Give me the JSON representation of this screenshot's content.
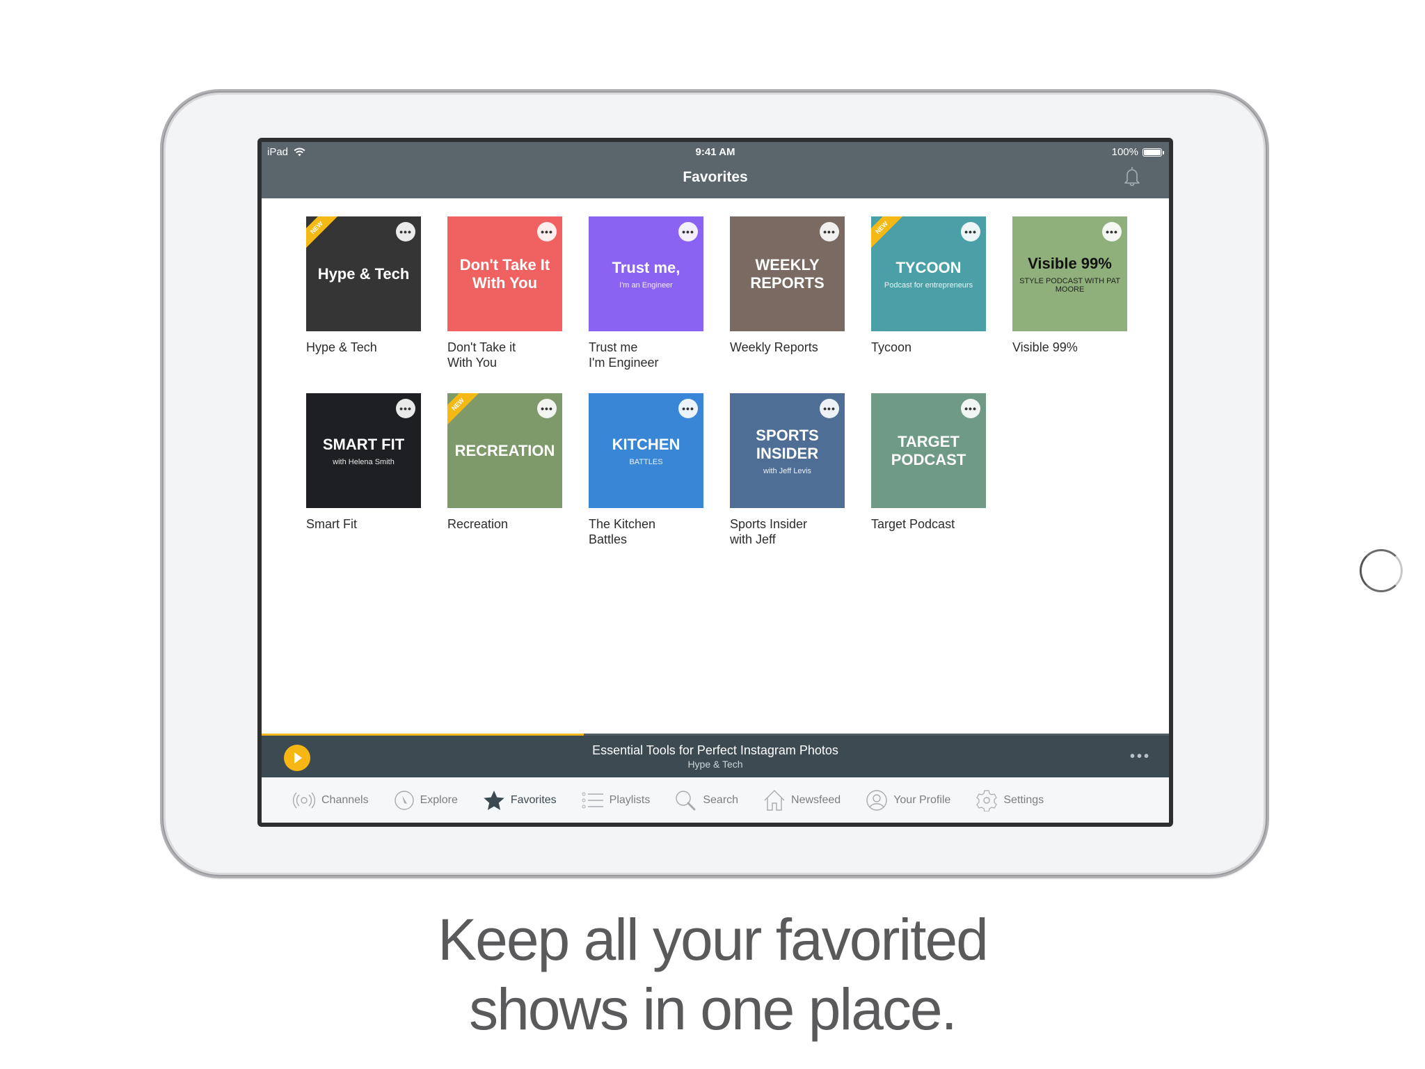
{
  "status_bar": {
    "device": "iPad",
    "time": "9:41 AM",
    "battery": "100%"
  },
  "nav": {
    "title": "Favorites",
    "bell_icon": "bell-icon"
  },
  "favorites": [
    {
      "title": "Hype & Tech",
      "art_text": "Hype & Tech",
      "art_sub": "",
      "is_new": true,
      "bg": "#353535",
      "fg": "#ffffff"
    },
    {
      "title": "Don't Take it\nWith You",
      "art_text": "Don't Take It With You",
      "art_sub": "",
      "is_new": false,
      "bg": "#f06162",
      "fg": "#ffffff"
    },
    {
      "title": "Trust me\nI'm Engineer",
      "art_text": "Trust me,",
      "art_sub": "I'm an Engineer",
      "is_new": false,
      "bg": "#8a63f2",
      "fg": "#ffffff"
    },
    {
      "title": "Weekly Reports",
      "art_text": "WEEKLY REPORTS",
      "art_sub": "",
      "is_new": false,
      "bg": "#7a6a62",
      "fg": "#ffffff"
    },
    {
      "title": "Tycoon",
      "art_text": "TYCOON",
      "art_sub": "Podcast for entrepreneurs",
      "is_new": true,
      "bg": "#4aa0a6",
      "fg": "#ffffff"
    },
    {
      "title": "Visible 99%",
      "art_text": "Visible 99%",
      "art_sub": "STYLE PODCAST WITH PAT MOORE",
      "is_new": false,
      "bg": "#8fb07a",
      "fg": "#111111"
    },
    {
      "title": "Smart Fit",
      "art_text": "SMART FIT",
      "art_sub": "with Helena Smith",
      "is_new": false,
      "bg": "#1e1f22",
      "fg": "#ffffff"
    },
    {
      "title": "Recreation",
      "art_text": "RECREATION",
      "art_sub": "",
      "is_new": true,
      "bg": "#7e9a6a",
      "fg": "#ffffff"
    },
    {
      "title": "The Kitchen\nBattles",
      "art_text": "KITCHEN",
      "art_sub": "BATTLES",
      "is_new": false,
      "bg": "#3a86d6",
      "fg": "#ffffff"
    },
    {
      "title": "Sports Insider\nwith Jeff",
      "art_text": "SPORTS INSIDER",
      "art_sub": "with Jeff Levis",
      "is_new": false,
      "bg": "#4f6e95",
      "fg": "#ffffff"
    },
    {
      "title": "Target Podcast",
      "art_text": "TARGET PODCAST",
      "art_sub": "",
      "is_new": false,
      "bg": "#6e9a86",
      "fg": "#ffffff"
    }
  ],
  "labels": {
    "new_badge": "NEW",
    "more": "•••"
  },
  "now_playing": {
    "title": "Essential Tools for Perfect Instagram Photos",
    "show": "Hype & Tech",
    "progress": 0.355,
    "more": "•••"
  },
  "tabs": [
    {
      "label": "Channels",
      "icon": "broadcast-icon",
      "active": false
    },
    {
      "label": "Explore",
      "icon": "compass-icon",
      "active": false
    },
    {
      "label": "Favorites",
      "icon": "star-icon",
      "active": true
    },
    {
      "label": "Playlists",
      "icon": "list-icon",
      "active": false
    },
    {
      "label": "Search",
      "icon": "search-icon",
      "active": false
    },
    {
      "label": "Newsfeed",
      "icon": "home-icon",
      "active": false
    },
    {
      "label": "Your Profile",
      "icon": "profile-icon",
      "active": false
    },
    {
      "label": "Settings",
      "icon": "gear-icon",
      "active": false
    }
  ],
  "caption": {
    "line1": "Keep all your favorited",
    "line2": "shows in one place."
  },
  "colors": {
    "accent": "#f6b614",
    "header": "#5b666c",
    "player": "#3c4a52"
  }
}
